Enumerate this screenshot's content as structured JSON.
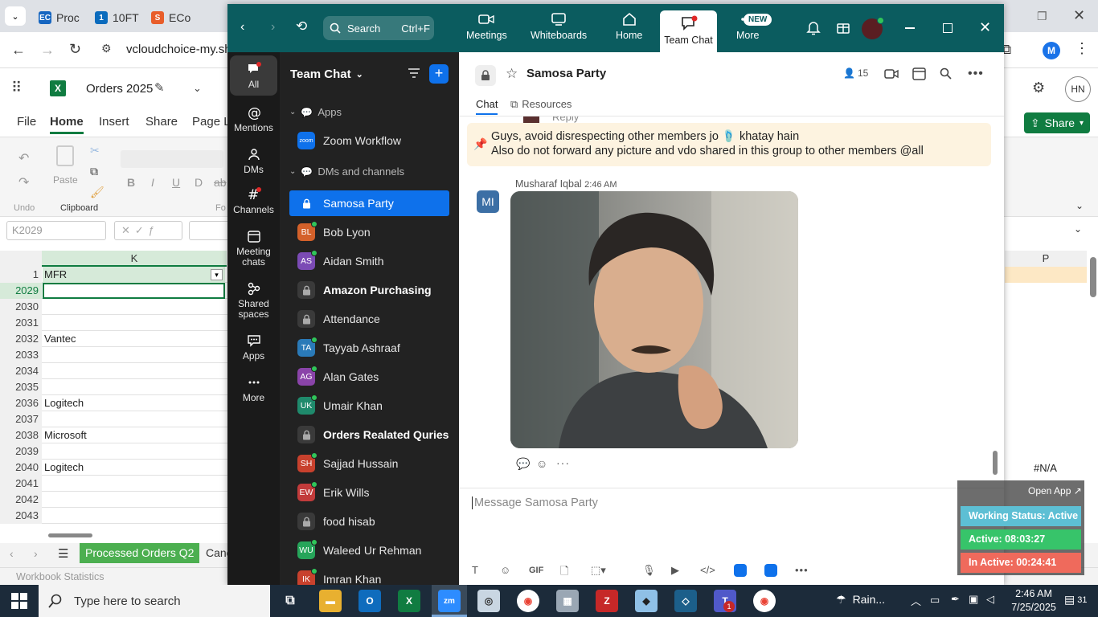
{
  "browser": {
    "tabs": [
      "Proc",
      "10FT",
      "ECo"
    ],
    "address": "vcloudchoice-my.sha",
    "profile_initial": "M"
  },
  "excel": {
    "file_title": "Orders 2025",
    "user_initials": "HN",
    "ribbon_tabs": [
      "File",
      "Home",
      "Insert",
      "Share",
      "Page La"
    ],
    "share_label": "Share",
    "undo_label": "Undo",
    "paste_label": "Paste",
    "clipboard_label": "Clipboard",
    "font_group_partial": "Fo",
    "name_box": "K2029",
    "column_k": "K",
    "column_p": "P",
    "header_row_num": "1",
    "header_cell": "MFR",
    "rows": [
      {
        "num": "2029",
        "value": ""
      },
      {
        "num": "2030",
        "value": ""
      },
      {
        "num": "2031",
        "value": ""
      },
      {
        "num": "2032",
        "value": "Vantec"
      },
      {
        "num": "2033",
        "value": ""
      },
      {
        "num": "2034",
        "value": ""
      },
      {
        "num": "2035",
        "value": ""
      },
      {
        "num": "2036",
        "value": "Logitech"
      },
      {
        "num": "2037",
        "value": ""
      },
      {
        "num": "2038",
        "value": "Microsoft"
      },
      {
        "num": "2039",
        "value": ""
      },
      {
        "num": "2040",
        "value": "Logitech"
      },
      {
        "num": "2041",
        "value": ""
      },
      {
        "num": "2042",
        "value": ""
      },
      {
        "num": "2043",
        "value": ""
      }
    ],
    "p_cell_value": "#N/A",
    "sheet_tab_active": "Processed Orders Q2",
    "sheet_tab_next": "Canc",
    "status_text": "Workbook Statistics"
  },
  "zoom": {
    "search_label": "Search",
    "search_shortcut": "Ctrl+F",
    "top_nav": [
      {
        "label": "Meetings",
        "icon": "video-icon"
      },
      {
        "label": "Whiteboards",
        "icon": "whiteboard-icon"
      },
      {
        "label": "Home",
        "icon": "home-icon"
      },
      {
        "label": "Team Chat",
        "icon": "chat-icon"
      },
      {
        "label": "More",
        "icon": "more-icon"
      }
    ],
    "new_badge": "NEW",
    "rail": [
      {
        "label": "All"
      },
      {
        "label": "Mentions"
      },
      {
        "label": "DMs"
      },
      {
        "label": "Channels"
      },
      {
        "label": "Meeting chats"
      },
      {
        "label": "Shared spaces"
      },
      {
        "label": "Apps"
      },
      {
        "label": "More"
      }
    ],
    "list_title": "Team Chat",
    "section_apps": "Apps",
    "section_dms": "DMs and channels",
    "zoom_app_badge": "zoom",
    "items": [
      {
        "label": "Zoom Workflow",
        "initials": "",
        "kind": "app"
      },
      {
        "label": "Samosa Party",
        "initials": "",
        "kind": "channel"
      },
      {
        "label": "Bob Lyon",
        "initials": "BL",
        "kind": "dm",
        "color": "#d4612a"
      },
      {
        "label": "Aidan Smith",
        "initials": "AS",
        "kind": "dm",
        "color": "#7b4bb5"
      },
      {
        "label": "Amazon Purchasing",
        "initials": "",
        "kind": "channel"
      },
      {
        "label": "Attendance",
        "initials": "",
        "kind": "channel"
      },
      {
        "label": "Tayyab Ashraaf",
        "initials": "TA",
        "kind": "dm",
        "color": "#2a7ab8"
      },
      {
        "label": "Alan Gates",
        "initials": "AG",
        "kind": "dm",
        "color": "#8a44a9"
      },
      {
        "label": "Umair Khan",
        "initials": "UK",
        "kind": "dm",
        "color": "#1f8a6c"
      },
      {
        "label": "Orders Realated Quries",
        "initials": "",
        "kind": "channel"
      },
      {
        "label": "Sajjad Hussain",
        "initials": "SH",
        "kind": "dm",
        "color": "#c8412d"
      },
      {
        "label": "Erik Wills",
        "initials": "EW",
        "kind": "dm",
        "color": "#c23b3b"
      },
      {
        "label": "food hisab",
        "initials": "",
        "kind": "channel"
      },
      {
        "label": "Waleed Ur Rehman",
        "initials": "WU",
        "kind": "dm",
        "color": "#26a55a"
      },
      {
        "label": "Imran Khan",
        "initials": "IK",
        "kind": "dm",
        "color": "#c8412d"
      }
    ],
    "chat": {
      "title": "Samosa Party",
      "member_count": "15",
      "tab_chat": "Chat",
      "tab_resources": "Resources",
      "reply_partial": "Reply",
      "pinned_line1": "Guys, avoid disrespecting other members jo 🩴 khatay hain",
      "pinned_line2": "Also do not forward any picture and vdo shared in this group to other members @all",
      "msg_sender": "Musharaf Iqbal",
      "msg_time": "2:46 AM",
      "msg_avatar": "MI",
      "composer_placeholder": "Message Samosa Party",
      "gif_label": "GIF"
    }
  },
  "open_app_label": "Open App ↗",
  "working_status": {
    "status": "Working Status: Active",
    "active": "Active: 08:03:27",
    "inactive": "In Active: 00:24:41"
  },
  "taskbar": {
    "search_placeholder": "Type here to search",
    "weather": "Rain...",
    "time": "2:46 AM",
    "date": "7/25/2025",
    "notif_count": "31",
    "teams_badge": "1"
  }
}
